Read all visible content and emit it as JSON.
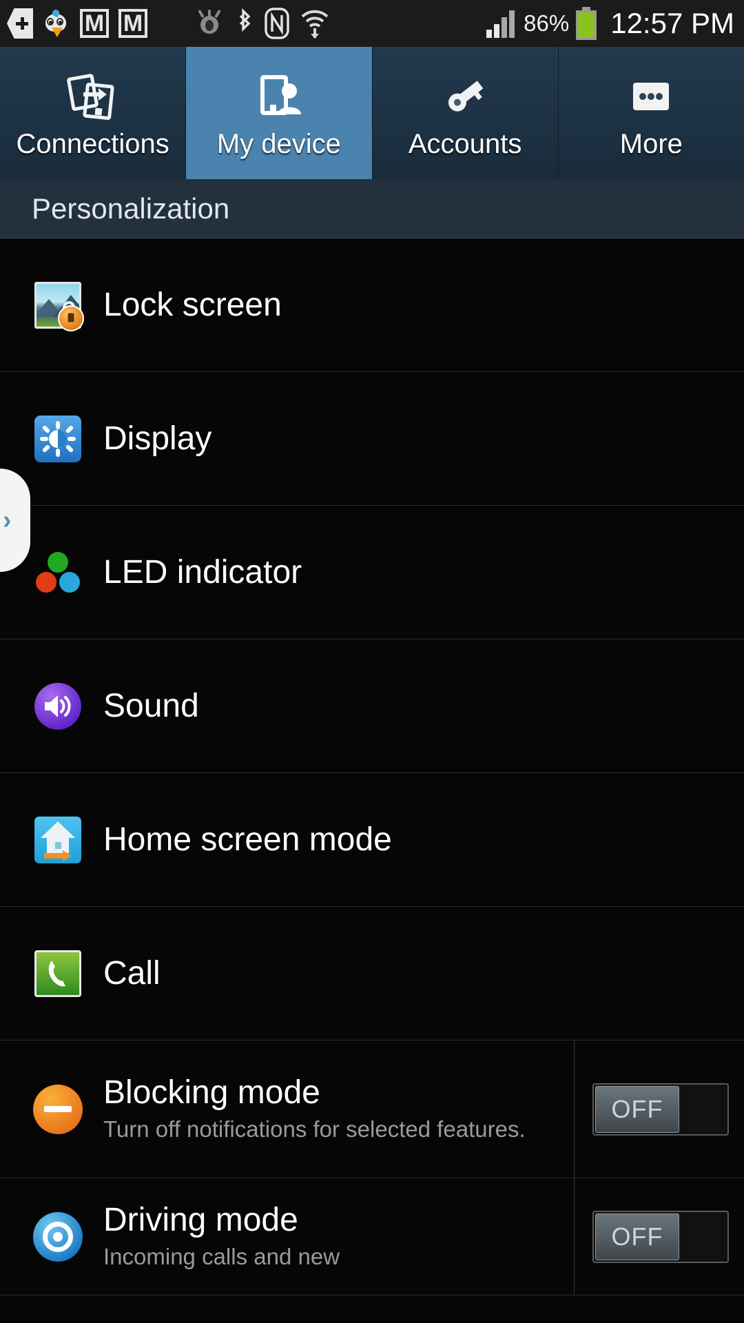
{
  "status_bar": {
    "icons": [
      {
        "name": "download-manager-icon",
        "glyph": "+"
      },
      {
        "name": "twitter-icon",
        "glyph": ""
      },
      {
        "name": "gmail-icon-1",
        "glyph": "M"
      },
      {
        "name": "gmail-icon-2",
        "glyph": "M"
      },
      {
        "name": "opera-eye-icon",
        "glyph": ""
      },
      {
        "name": "bluetooth-icon",
        "glyph": ""
      },
      {
        "name": "nfc-icon",
        "glyph": "N"
      },
      {
        "name": "wifi-icon",
        "glyph": ""
      },
      {
        "name": "cellular-signal-icon",
        "glyph": ""
      }
    ],
    "battery_percent": "86%",
    "battery_level": 86,
    "clock": "12:57 PM"
  },
  "tabs": [
    {
      "label": "Connections",
      "icon": "connections-icon",
      "active": false
    },
    {
      "label": "My device",
      "icon": "my-device-icon",
      "active": true
    },
    {
      "label": "Accounts",
      "icon": "accounts-icon",
      "active": false
    },
    {
      "label": "More",
      "icon": "more-icon",
      "active": false
    }
  ],
  "section": {
    "title": "Personalization"
  },
  "list": [
    {
      "title": "Lock screen",
      "subtitle": "",
      "icon": "lock-screen-icon",
      "toggle": null
    },
    {
      "title": "Display",
      "subtitle": "",
      "icon": "display-icon",
      "toggle": null
    },
    {
      "title": "LED indicator",
      "subtitle": "",
      "icon": "led-indicator-icon",
      "toggle": null
    },
    {
      "title": "Sound",
      "subtitle": "",
      "icon": "sound-icon",
      "toggle": null
    },
    {
      "title": "Home screen mode",
      "subtitle": "",
      "icon": "home-screen-mode-icon",
      "toggle": null
    },
    {
      "title": "Call",
      "subtitle": "",
      "icon": "call-icon",
      "toggle": null
    },
    {
      "title": "Blocking mode",
      "subtitle": "Turn off notifications for selected features.",
      "icon": "blocking-mode-icon",
      "toggle": "OFF"
    },
    {
      "title": "Driving mode",
      "subtitle": "Incoming calls and new",
      "icon": "driving-mode-icon",
      "toggle": "OFF"
    }
  ],
  "edge_panel": {
    "chevron": "›"
  },
  "colors": {
    "tab_active": "#4a83ad",
    "tab_inactive": "#1d3446",
    "section_header_bg": "#22313d",
    "page_bg": "#060606",
    "battery_green": "#8bc220"
  }
}
